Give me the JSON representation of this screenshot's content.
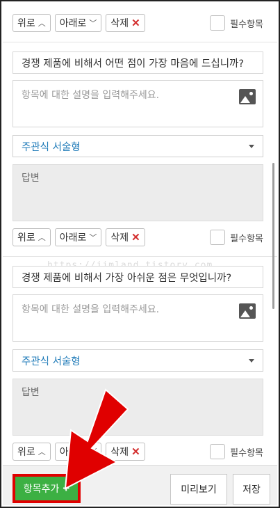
{
  "controls": {
    "up_label": "위로",
    "down_label": "아래로",
    "delete_label": "삭제",
    "delete_mark": "✕",
    "up_chevron": "︿",
    "down_chevron": "﹀",
    "required_label": "필수항목"
  },
  "questions": [
    {
      "title": "경쟁 제품에 비해서 어떤 점이 가장 마음에 드십니까?",
      "description_placeholder": "항목에 대한 설명을 입력해주세요.",
      "type_selected": "주관식 서술형",
      "answer_label": "답변"
    },
    {
      "title": "경쟁 제품에 비해서 가장 아쉬운 점은 무엇입니까?",
      "description_placeholder": "항목에 대한 설명을 입력해주세요.",
      "type_selected": "주관식 서술형",
      "answer_label": "답변"
    }
  ],
  "watermark": "https://jimland.tistory.com",
  "footer": {
    "add_label": "항목추가",
    "add_plus": "+",
    "preview_label": "미리보기",
    "save_label": "저장"
  },
  "colors": {
    "add_button": "#3cb043",
    "highlight": "#e00000",
    "select_text": "#1e7ab8",
    "delete_x": "#d32f2f"
  },
  "icons": [
    "image-icon",
    "chevron-up-icon",
    "chevron-down-icon",
    "close-icon",
    "caret-down-icon",
    "plus-icon"
  ]
}
